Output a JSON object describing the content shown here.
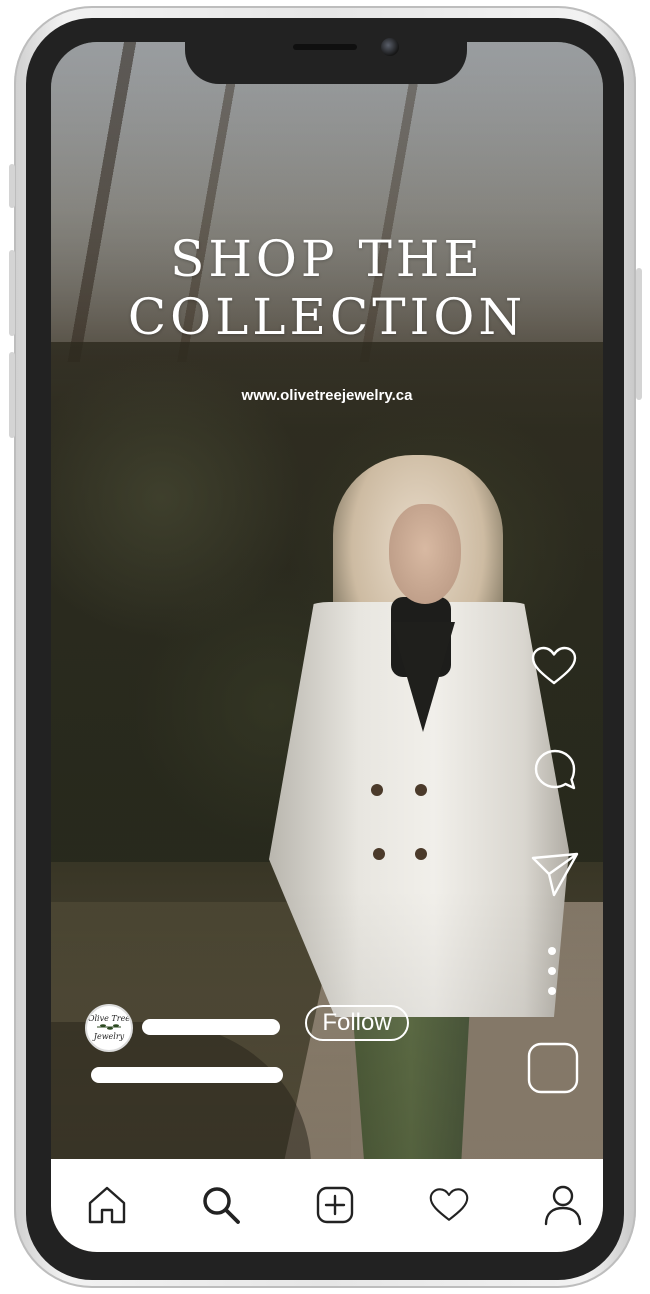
{
  "post": {
    "headline_line1": "SHOP THE",
    "headline_line2": "COLLECTION",
    "website": "www.olivetreejewelry.ca"
  },
  "account": {
    "avatar_text_line1": "Olive Tree",
    "avatar_text_line2": "Jewelry",
    "follow_label": "Follow"
  },
  "actions": {
    "like_icon": "heart-outline-icon",
    "comment_icon": "speech-bubble-icon",
    "share_icon": "paper-plane-icon",
    "more_icon": "vertical-dots-icon",
    "audio_icon": "rounded-square-icon"
  },
  "nav": {
    "items": [
      {
        "icon": "home-icon"
      },
      {
        "icon": "search-icon"
      },
      {
        "icon": "add-post-icon"
      },
      {
        "icon": "activity-heart-icon"
      },
      {
        "icon": "profile-icon"
      }
    ]
  },
  "colors": {
    "overlay_text": "#ffffff",
    "navbar": "#ffffff",
    "icon_dark": "#222222",
    "bezel": "#222222"
  }
}
